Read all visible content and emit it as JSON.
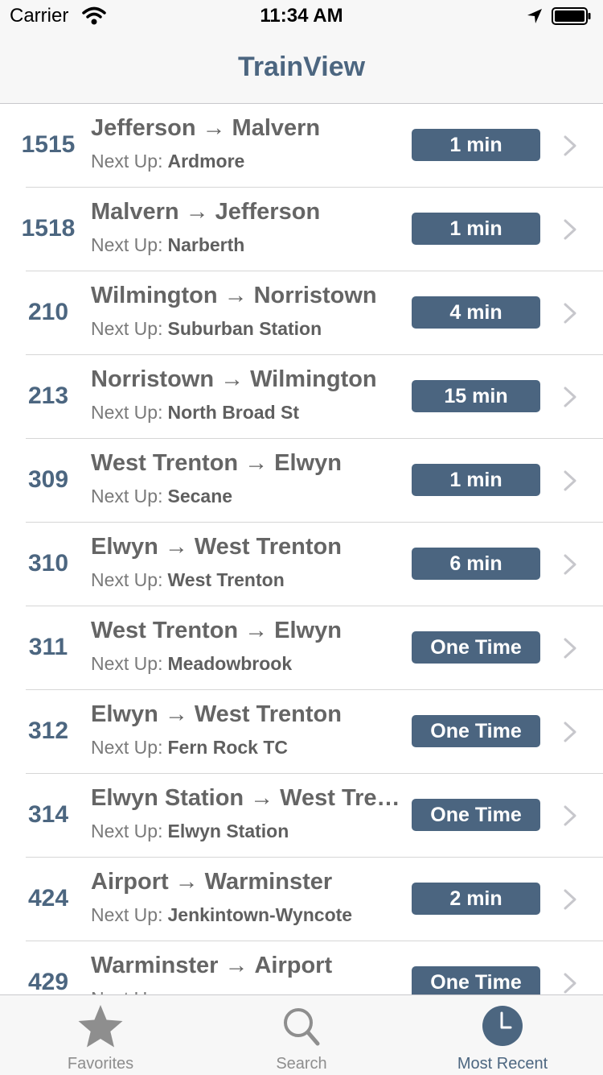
{
  "status_bar": {
    "carrier": "Carrier",
    "time": "11:34 AM",
    "icons": [
      "wifi-icon",
      "location-arrow-icon",
      "battery-icon"
    ]
  },
  "nav": {
    "title": "TrainView"
  },
  "trains": [
    {
      "number": "1515",
      "from": "Jefferson",
      "to": "Malvern",
      "next_label": "Next Up:",
      "next_stop": "Ardmore",
      "status": "1 min"
    },
    {
      "number": "1518",
      "from": "Malvern",
      "to": "Jefferson",
      "next_label": "Next Up:",
      "next_stop": "Narberth",
      "status": "1 min"
    },
    {
      "number": "210",
      "from": "Wilmington",
      "to": "Norristown",
      "next_label": "Next Up:",
      "next_stop": "Suburban Station",
      "status": "4 min"
    },
    {
      "number": "213",
      "from": "Norristown",
      "to": "Wilmington",
      "next_label": "Next Up:",
      "next_stop": "North Broad St",
      "status": "15 min"
    },
    {
      "number": "309",
      "from": "West Trenton",
      "to": "Elwyn",
      "next_label": "Next Up:",
      "next_stop": "Secane",
      "status": "1 min"
    },
    {
      "number": "310",
      "from": "Elwyn",
      "to": "West Trenton",
      "next_label": "Next Up:",
      "next_stop": "West Trenton",
      "status": "6 min"
    },
    {
      "number": "311",
      "from": "West Trenton",
      "to": "Elwyn",
      "next_label": "Next Up:",
      "next_stop": "Meadowbrook",
      "status": "One Time"
    },
    {
      "number": "312",
      "from": "Elwyn",
      "to": "West Trenton",
      "next_label": "Next Up:",
      "next_stop": "Fern Rock TC",
      "status": "One Time"
    },
    {
      "number": "314",
      "from": "Elwyn Station",
      "to": "West Tren...",
      "next_label": "Next Up:",
      "next_stop": "Elwyn Station",
      "status": "One Time"
    },
    {
      "number": "424",
      "from": "Airport",
      "to": "Warminster",
      "next_label": "Next Up:",
      "next_stop": "Jenkintown-Wyncote",
      "status": "2 min"
    },
    {
      "number": "429",
      "from": "Warminster",
      "to": "Airport",
      "next_label": "Next Up:",
      "next_stop": "",
      "status": "One Time"
    }
  ],
  "tabs": [
    {
      "label": "Favorites",
      "icon": "star-icon",
      "active": false
    },
    {
      "label": "Search",
      "icon": "search-icon",
      "active": false
    },
    {
      "label": "Most Recent",
      "icon": "clock-icon",
      "active": true
    }
  ],
  "colors": {
    "accent": "#4c6680",
    "badge": "#4b6580",
    "bar_background": "#f7f7f7",
    "inactive_tab": "#8e8e8e"
  }
}
